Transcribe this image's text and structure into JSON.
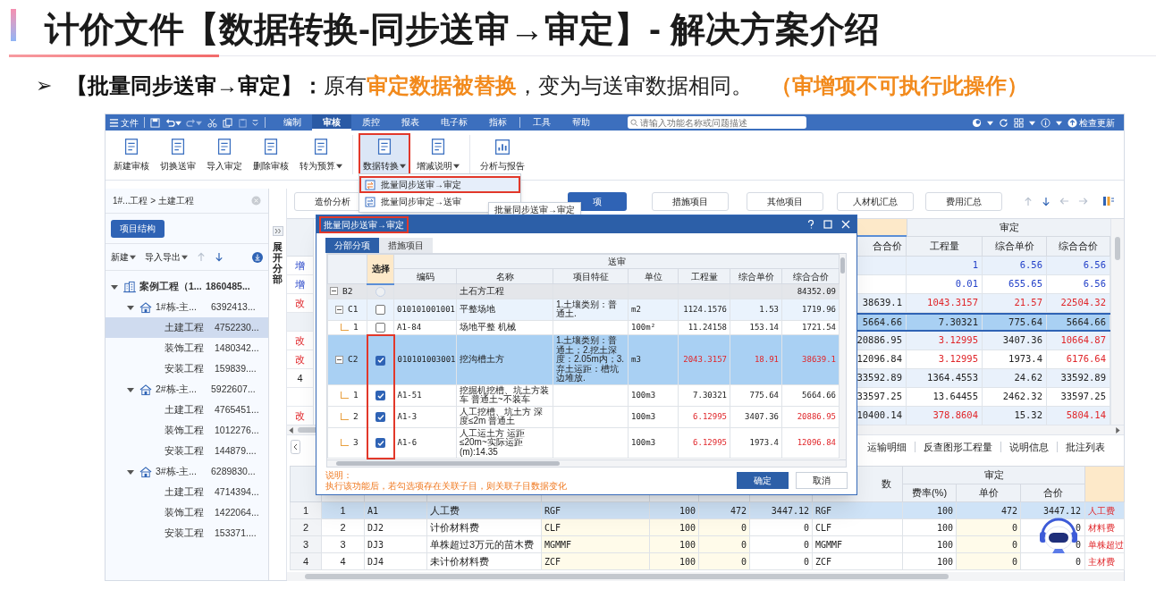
{
  "slide": {
    "title": "计价文件【数据转换-同步送审→审定】- 解决方案介绍",
    "bullet_mark": "➢",
    "bullet": [
      {
        "text": "【批量同步送审→审定】：",
        "kind": "bold"
      },
      {
        "text": "原有",
        "kind": "plain"
      },
      {
        "text": "审定数据被替换",
        "kind": "emphasis"
      },
      {
        "text": "，变为与送审数据相同。",
        "kind": "plain"
      },
      {
        "text": "（审增项不可执行此操作）",
        "kind": "note"
      }
    ]
  },
  "menu_bar": {
    "file": "文件",
    "tabs": [
      {
        "label": "编制",
        "selected": false
      },
      {
        "label": "审核",
        "selected": true
      },
      {
        "label": "质控",
        "selected": false
      },
      {
        "label": "报表",
        "selected": false
      },
      {
        "label": "电子标",
        "selected": false
      },
      {
        "label": "指标",
        "selected": false
      },
      {
        "label": "工具",
        "selected": false
      },
      {
        "label": "帮助",
        "selected": false
      }
    ],
    "search": {
      "placeholder": "请输入功能名称或问题描述"
    },
    "update": "检查更新"
  },
  "ribbon": {
    "buttons": [
      {
        "label": "新建审核",
        "dropdown": false,
        "highlighted": false
      },
      {
        "label": "切换送审",
        "dropdown": false,
        "highlighted": false
      },
      {
        "label": "导入审定",
        "dropdown": false,
        "highlighted": false
      },
      {
        "label": "删除审核",
        "dropdown": false,
        "highlighted": false
      },
      {
        "label": "转为预算",
        "dropdown": true,
        "highlighted": false
      },
      {
        "label": "数据转换",
        "dropdown": true,
        "highlighted": true
      },
      {
        "label": "增减说明",
        "dropdown": true,
        "highlighted": false
      },
      {
        "label": "分析与报告",
        "dropdown": false,
        "highlighted": false
      }
    ],
    "menu": [
      {
        "label": "批量同步送审→审定",
        "highlighted": true
      },
      {
        "label": "批量同步审定→送审",
        "highlighted": false
      }
    ]
  },
  "project_panel": {
    "breadcrumb": "1#...工程 > 土建工程",
    "structure_button": "项目结构",
    "toolbar": [
      "新建",
      "导入导出"
    ],
    "tree": [
      {
        "label": "案例工程（1...",
        "value": "1860485...",
        "kind": "project",
        "expanded": true,
        "selected": false,
        "children": [
          {
            "label": "1#栋-主...",
            "value": "6392413...",
            "kind": "building",
            "expanded": true,
            "selected": false,
            "children": [
              {
                "label": "土建工程",
                "value": "4752230...",
                "kind": "unit",
                "selected": true
              },
              {
                "label": "装饰工程",
                "value": "1480342...",
                "kind": "unit",
                "selected": false
              },
              {
                "label": "安装工程",
                "value": "159839....",
                "kind": "unit",
                "selected": false
              }
            ]
          },
          {
            "label": "2#栋-主...",
            "value": "5922607...",
            "kind": "building",
            "expanded": true,
            "selected": false,
            "children": [
              {
                "label": "土建工程",
                "value": "4765451...",
                "kind": "unit",
                "selected": false
              },
              {
                "label": "装饰工程",
                "value": "1012276...",
                "kind": "unit",
                "selected": false
              },
              {
                "label": "安装工程",
                "value": "144879....",
                "kind": "unit",
                "selected": false
              }
            ]
          },
          {
            "label": "3#栋-主...",
            "value": "6289830...",
            "kind": "building",
            "expanded": true,
            "selected": false,
            "children": [
              {
                "label": "土建工程",
                "value": "4714394...",
                "kind": "unit",
                "selected": false
              },
              {
                "label": "装饰工程",
                "value": "1422064...",
                "kind": "unit",
                "selected": false
              },
              {
                "label": "安装工程",
                "value": "153371....",
                "kind": "unit",
                "selected": false
              }
            ]
          }
        ]
      }
    ]
  },
  "view_tabs": [
    {
      "label": "造价分析",
      "selected": false
    },
    {
      "label": "项",
      "selected": true
    },
    {
      "label": "措施项目",
      "selected": false
    },
    {
      "label": "其他项目",
      "selected": false
    },
    {
      "label": "人材机汇总",
      "selected": false
    },
    {
      "label": "费用汇总",
      "selected": false
    }
  ],
  "tooltip": "批量同步送审→审定",
  "side_strip": {
    "label": "展开分部"
  },
  "main_grid": {
    "group_header": "审定",
    "columns": [
      "合合价",
      "工程量",
      "综合单价",
      "综合合价"
    ],
    "rows": [
      {
        "marker": {
          "text": "增",
          "kind": "added"
        },
        "added": true,
        "selected": false,
        "cells": [
          {
            "text": "1",
            "changed": false
          },
          {
            "text": "6.56",
            "changed": false
          },
          {
            "text": "6.56",
            "changed": false
          }
        ]
      },
      {
        "marker": {
          "text": "增",
          "kind": "added"
        },
        "added": true,
        "selected": false,
        "cells": [
          {
            "text": "0.01",
            "changed": false
          },
          {
            "text": "655.65",
            "changed": false
          },
          {
            "text": "6.56",
            "changed": false
          }
        ]
      },
      {
        "marker": {
          "text": "改",
          "kind": "changed"
        },
        "added": false,
        "selected": false,
        "cells": [
          {
            "text": "38639.1",
            "changed": false
          },
          {
            "text": "1043.3157",
            "changed": true
          },
          {
            "text": "21.57",
            "changed": true
          },
          {
            "text": "22504.32",
            "changed": true
          }
        ]
      },
      {
        "added": false,
        "selected": true,
        "cells": [
          {
            "text": "5664.66",
            "changed": false
          },
          {
            "text": "7.30321",
            "changed": false
          },
          {
            "text": "775.64",
            "changed": false
          },
          {
            "text": "5664.66",
            "changed": false
          }
        ]
      },
      {
        "marker": {
          "text": "改",
          "kind": "changed"
        },
        "added": false,
        "selected": false,
        "cells": [
          {
            "text": "20886.95",
            "changed": false
          },
          {
            "text": "3.12995",
            "changed": true
          },
          {
            "text": "3407.36",
            "changed": false
          },
          {
            "text": "10664.87",
            "changed": true
          }
        ]
      },
      {
        "marker": {
          "text": "改",
          "kind": "changed"
        },
        "added": false,
        "selected": false,
        "cells": [
          {
            "text": "12096.84",
            "changed": false
          },
          {
            "text": "3.12995",
            "changed": true
          },
          {
            "text": "1973.4",
            "changed": false
          },
          {
            "text": "6176.64",
            "changed": true
          }
        ]
      },
      {
        "marker": {
          "text": "4",
          "kind": "number"
        },
        "added": false,
        "selected": false,
        "cells": [
          {
            "text": "33592.89",
            "changed": false
          },
          {
            "text": "1364.4553",
            "changed": false
          },
          {
            "text": "24.62",
            "changed": false
          },
          {
            "text": "33592.89",
            "changed": false
          }
        ]
      },
      {
        "added": false,
        "selected": false,
        "cells": [
          {
            "text": "33597.25",
            "changed": false
          },
          {
            "text": "13.64455",
            "changed": false
          },
          {
            "text": "2462.32",
            "changed": false
          },
          {
            "text": "33597.25",
            "changed": false
          }
        ]
      },
      {
        "marker": {
          "text": "改",
          "kind": "changed"
        },
        "added": false,
        "selected": false,
        "cells": [
          {
            "text": "10400.14",
            "changed": false
          },
          {
            "text": "378.8604",
            "changed": true
          },
          {
            "text": "15.32",
            "changed": false
          },
          {
            "text": "5804.14",
            "changed": true
          }
        ]
      }
    ]
  },
  "detail_tabs": [
    "运输明细",
    "反查图形工程量",
    "说明信息",
    "批注列表"
  ],
  "fee_table": {
    "group_header": "审定",
    "header_labels": [
      "数",
      "费率(%)",
      "单价",
      "合价"
    ],
    "rows": [
      {
        "selected": true,
        "cells": [
          "1",
          "1",
          "A1",
          "人工费",
          "RGF",
          "100",
          "472",
          "3447.12",
          "RGF",
          "100",
          "472",
          "3447.12",
          "人工费"
        ]
      },
      {
        "selected": false,
        "cells": [
          "2",
          "2",
          "DJ2",
          "计价材料费",
          "CLF",
          "100",
          "0",
          "0",
          "CLF",
          "100",
          "0",
          "0",
          "材料费"
        ]
      },
      {
        "selected": false,
        "cells": [
          "3",
          "3",
          "DJ3",
          "单株超过3万元的苗木费",
          "MGMMF",
          "100",
          "0",
          "0",
          "MGMMF",
          "100",
          "0",
          "0",
          "单株超过"
        ]
      },
      {
        "selected": false,
        "cells": [
          "4",
          "4",
          "DJ4",
          "未计价材料费",
          "ZCF",
          "100",
          "0",
          "0",
          "ZCF",
          "100",
          "0",
          "0",
          "主材费"
        ]
      }
    ]
  },
  "dialog": {
    "title": "批量同步送审→审定",
    "title_highlighted": true,
    "tabs": [
      {
        "label": "分部分项",
        "selected": true
      },
      {
        "label": "措施项目",
        "selected": false
      }
    ],
    "group_header": "送审",
    "select_header": "选择",
    "columns": [
      "编码",
      "名称",
      "项目特征",
      "单位",
      "工程量",
      "综合单价",
      "综合合价"
    ],
    "rows": [
      {
        "level": "B2",
        "kind": "section",
        "expanded": true,
        "checked": false,
        "disabled": true,
        "framed": false,
        "selected": false,
        "name": "土石方工程",
        "total": {
          "text": "84352.09",
          "changed": false
        },
        "children": [
          {
            "level": "C1",
            "kind": "item",
            "expanded": true,
            "checked": false,
            "disabled": false,
            "framed": false,
            "selected": false,
            "code": "010101001001",
            "name": "平整场地",
            "feature": "1.土壤类别：普通土.",
            "unit": "m2",
            "qty": {
              "text": "1124.1576",
              "changed": false
            },
            "price": {
              "text": "1.53",
              "changed": false
            },
            "total": {
              "text": "1719.96",
              "changed": false
            },
            "children": [
              {
                "level": "1",
                "kind": "quota",
                "checked": false,
                "disabled": false,
                "framed": false,
                "selected": false,
                "code": "A1-84",
                "name": "场地平整 机械",
                "unit": "100m²",
                "qty": {
                  "text": "11.24158",
                  "changed": false
                },
                "price": {
                  "text": "153.14",
                  "changed": false
                },
                "total": {
                  "text": "1721.54",
                  "changed": false
                }
              }
            ]
          },
          {
            "level": "C2",
            "kind": "item",
            "expanded": true,
            "checked": true,
            "disabled": false,
            "framed": true,
            "selected": true,
            "code": "010101003001",
            "name": "挖沟槽土方",
            "feature": "1.土壤类别：普通土；2.挖土深度：2.05m内；3.弃土运距：槽坑边堆放.",
            "unit": "m3",
            "qty": {
              "text": "2043.3157",
              "changed": true
            },
            "price": {
              "text": "18.91",
              "changed": true
            },
            "total": {
              "text": "38639.1",
              "changed": true
            },
            "children": [
              {
                "level": "1",
                "kind": "quota",
                "checked": true,
                "disabled": false,
                "framed": true,
                "selected": false,
                "code": "A1-51",
                "name": "挖掘机挖槽、坑土方装车 普通土~不装车",
                "unit": "100m3",
                "qty": {
                  "text": "7.30321",
                  "changed": false
                },
                "price": {
                  "text": "775.64",
                  "changed": false
                },
                "total": {
                  "text": "5664.66",
                  "changed": false
                }
              },
              {
                "level": "2",
                "kind": "quota",
                "checked": true,
                "disabled": false,
                "framed": true,
                "selected": false,
                "code": "A1-3",
                "name": "人工挖槽、坑土方 深度≤2m 普通土",
                "unit": "100m3",
                "qty": {
                  "text": "6.12995",
                  "changed": true
                },
                "price": {
                  "text": "3407.36",
                  "changed": false
                },
                "total": {
                  "text": "20886.95",
                  "changed": true
                }
              },
              {
                "level": "3",
                "kind": "quota",
                "checked": true,
                "disabled": false,
                "framed": true,
                "selected": false,
                "code": "A1-6",
                "name": "人工运土方 运距≤20m~实际运距(m):14.35",
                "unit": "100m3",
                "qty": {
                  "text": "6.12995",
                  "changed": true
                },
                "price": {
                  "text": "1973.4",
                  "changed": false
                },
                "total": {
                  "text": "12096.84",
                  "changed": true
                }
              }
            ]
          }
        ]
      }
    ],
    "note_title": "说明：",
    "note": "执行该功能后，若勾选项存在关联子目，则关联子目数据变化",
    "ok": "确定",
    "cancel": "取消"
  }
}
